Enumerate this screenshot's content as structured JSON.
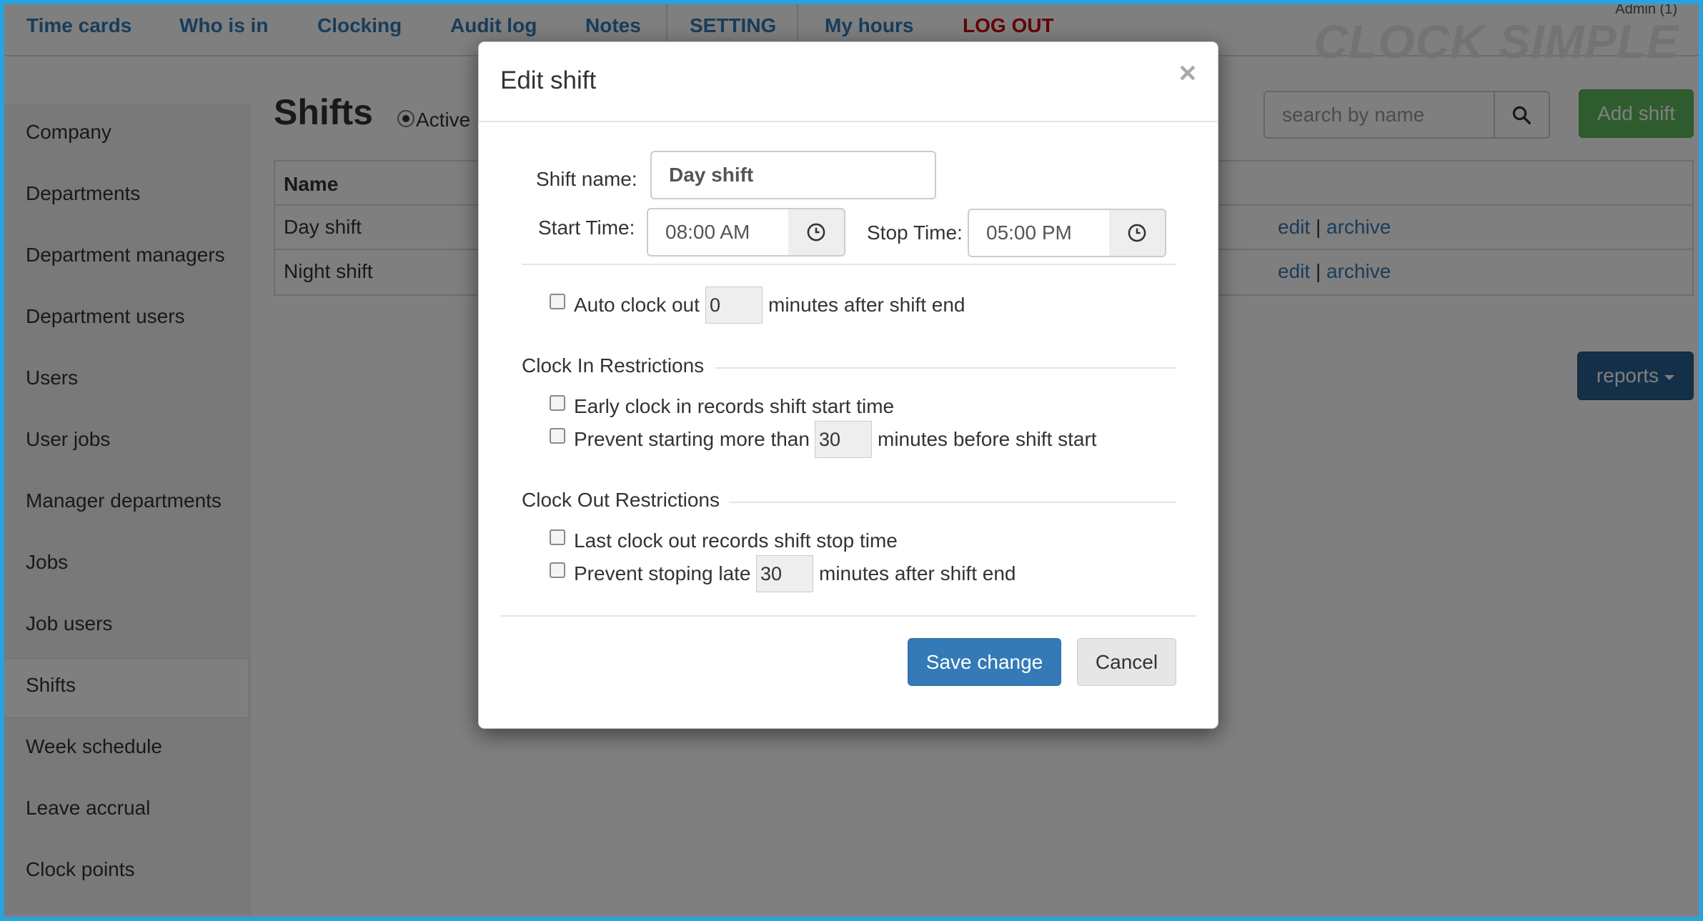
{
  "nav": {
    "items": [
      {
        "label": "Time cards"
      },
      {
        "label": "Who is in"
      },
      {
        "label": "Clocking"
      },
      {
        "label": "Audit log"
      },
      {
        "label": "Notes"
      },
      {
        "label": "SETTING"
      },
      {
        "label": "My hours"
      },
      {
        "label": "LOG OUT"
      }
    ],
    "admin": "Admin (1)",
    "logo": "CLOCK SIMPLE"
  },
  "sidebar": {
    "items": [
      {
        "label": "Company"
      },
      {
        "label": "Departments"
      },
      {
        "label": "Department managers"
      },
      {
        "label": "Department users"
      },
      {
        "label": "Users"
      },
      {
        "label": "User jobs"
      },
      {
        "label": "Manager departments"
      },
      {
        "label": "Jobs"
      },
      {
        "label": "Job users"
      },
      {
        "label": "Shifts"
      },
      {
        "label": "Week schedule"
      },
      {
        "label": "Leave accrual"
      },
      {
        "label": "Clock points"
      }
    ],
    "active": "Shifts"
  },
  "main": {
    "title": "Shifts",
    "filter_label": "Active",
    "search_placeholder": "search by name",
    "add_button": "Add shift",
    "table": {
      "header": "Name",
      "rows": [
        {
          "name": "Day shift",
          "edit": "edit",
          "sep": "|",
          "archive": "archive"
        },
        {
          "name": "Night shift",
          "edit": "edit",
          "sep": "|",
          "archive": "archive"
        }
      ]
    },
    "reports_button": "reports"
  },
  "modal": {
    "title": "Edit shift",
    "close": "×",
    "shift_name_label": "Shift name:",
    "shift_name_value": "Day shift",
    "start_label": "Start Time:",
    "start_value": "08:00 AM",
    "stop_label": "Stop Time:",
    "stop_value": "05:00 PM",
    "auto_clock_out": {
      "label": "Auto clock out",
      "value": "0",
      "suffix": "minutes after shift end",
      "checked": false
    },
    "clock_in": {
      "legend": "Clock In Restrictions",
      "early_label": "Early clock in records shift start time",
      "prevent_label": "Prevent starting more than",
      "prevent_value": "30",
      "prevent_suffix": "minutes before shift start"
    },
    "clock_out": {
      "legend": "Clock Out Restrictions",
      "last_label": "Last clock out records shift stop time",
      "prevent_label": "Prevent stoping late",
      "prevent_value": "30",
      "prevent_suffix": "minutes after shift end"
    },
    "save_button": "Save change",
    "cancel_button": "Cancel"
  },
  "colors": {
    "link": "#337ab7",
    "success": "#5cb85c",
    "primary": "#337ab7",
    "reports": "#286090",
    "danger": "#cc0000",
    "frame": "#29a3dc"
  },
  "icons": {
    "search": "search-icon",
    "clock": "clock-icon",
    "close": "close-icon",
    "caret": "caret-down-icon"
  }
}
